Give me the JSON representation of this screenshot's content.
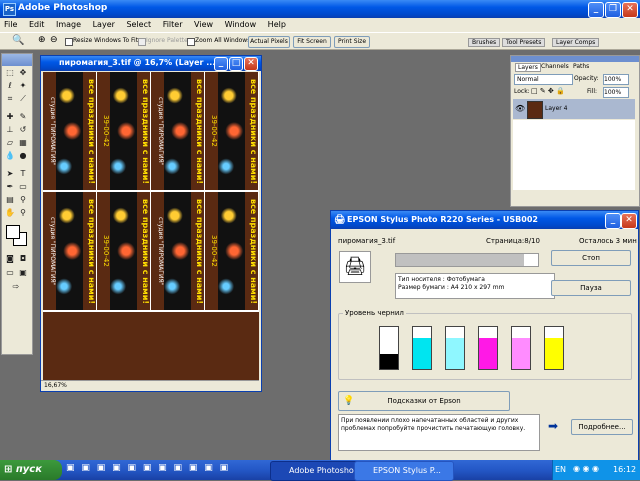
{
  "app": {
    "title": "Adobe Photoshop"
  },
  "menu": [
    "File",
    "Edit",
    "Image",
    "Layer",
    "Select",
    "Filter",
    "View",
    "Window",
    "Help"
  ],
  "options_bar": {
    "resize_windows": "Resize Windows To Fit",
    "ignore_palettes": "Ignore Palettes",
    "zoom_all": "Zoom All Windows",
    "actual_pixels": "Actual Pixels",
    "fit_screen": "Fit Screen",
    "print_size": "Print Size"
  },
  "palette_tabs": [
    "Brushes",
    "Tool Presets",
    "Layer Comps"
  ],
  "layers": {
    "tabs": [
      "Layers",
      "Channels",
      "Paths"
    ],
    "blend_mode": "Normal",
    "opacity_label": "Opacity:",
    "opacity": "100%",
    "lock_label": "Lock:",
    "fill_label": "Fill:",
    "fill": "100%",
    "layer_name": "Layer 4"
  },
  "document": {
    "title": "пиромагия_3.tif @ 16,7% (Layer ...",
    "zoom": "16,67%",
    "poster": {
      "slogan": "все праздники с нами!",
      "brand": "студия \"ПИРОМАГИЯ\"",
      "phone": "39-00-42"
    }
  },
  "epson": {
    "title": "EPSON Stylus Photo R220 Series - USB002",
    "file": "пиромагия_3.tif",
    "page": "Страница:8/10",
    "remaining": "Осталось 3 мин",
    "progress": 0.9,
    "stop": "Стоп",
    "pause": "Пауза",
    "media_type": "Тип носителя : Фотобумага",
    "paper_size": "Размер бумаги : A4 210 x 297 mm",
    "ink_label": "Уровень чернил",
    "inks": [
      {
        "color": "#000000",
        "level": 0.35
      },
      {
        "color": "#00e5f0",
        "level": 0.75
      },
      {
        "color": "#8ff7ff",
        "level": 0.75
      },
      {
        "color": "#ff19e6",
        "level": 0.75
      },
      {
        "color": "#ff8cff",
        "level": 0.75
      },
      {
        "color": "#ffff00",
        "level": 0.75
      }
    ],
    "tips_button": "Подсказки от Epson",
    "tip_text": "При появлении плохо напечатанных областей и других проблемах попробуйте прочистить печатающую головку.",
    "more_button": "Подробнее..."
  },
  "taskbar": {
    "start": "пуск",
    "tasks": [
      "Adobe Photoshop",
      "EPSON Stylus P..."
    ],
    "lang": "EN",
    "clock": "16:12"
  }
}
